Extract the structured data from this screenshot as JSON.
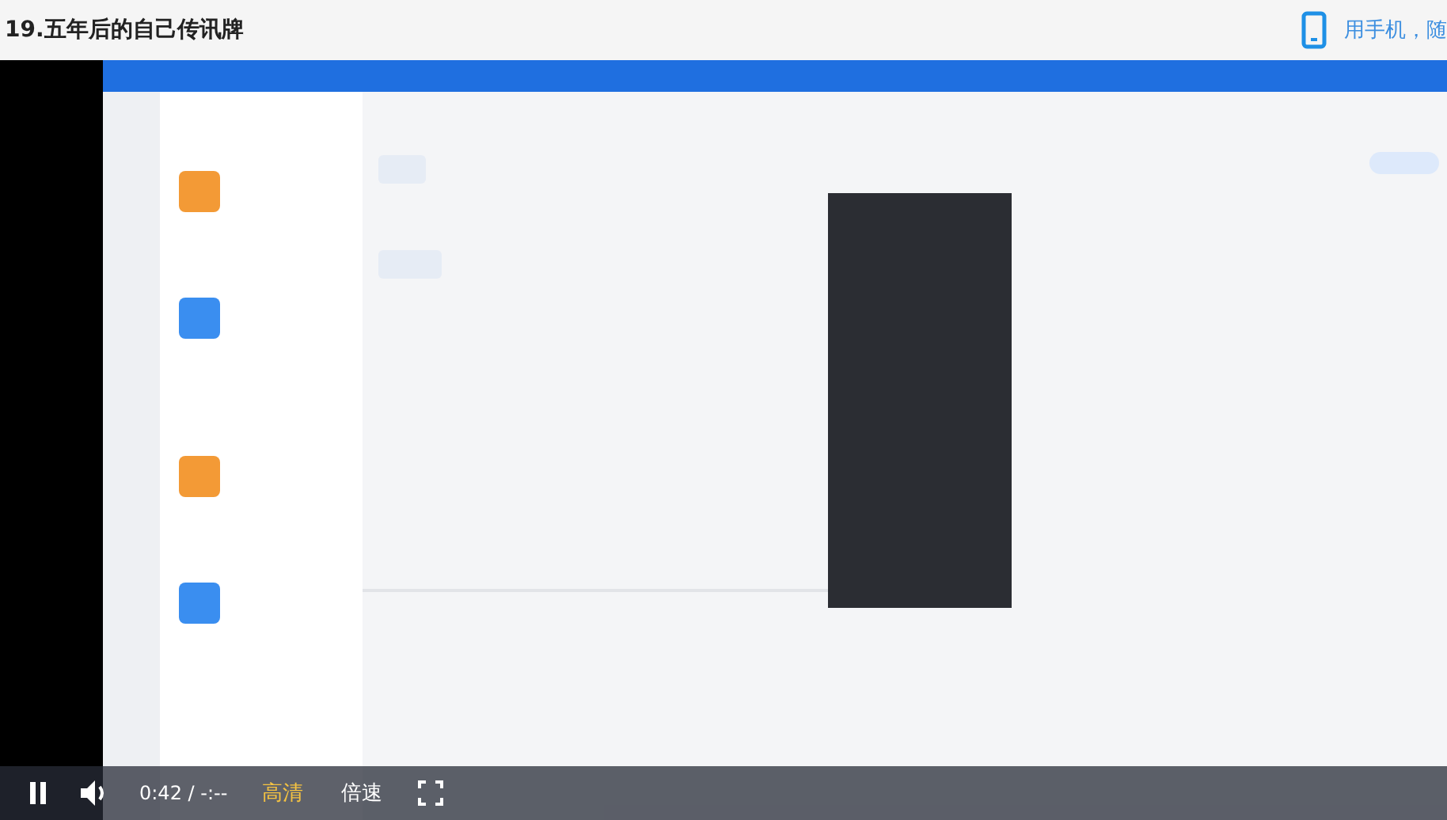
{
  "page_title": "19.五年后的自己传讯牌",
  "mobile_link": "用手机，随",
  "video": {
    "kind": "picture",
    "playing": true,
    "time": "0:42 / -:--",
    "quality": "高清",
    "speed": "倍速"
  }
}
